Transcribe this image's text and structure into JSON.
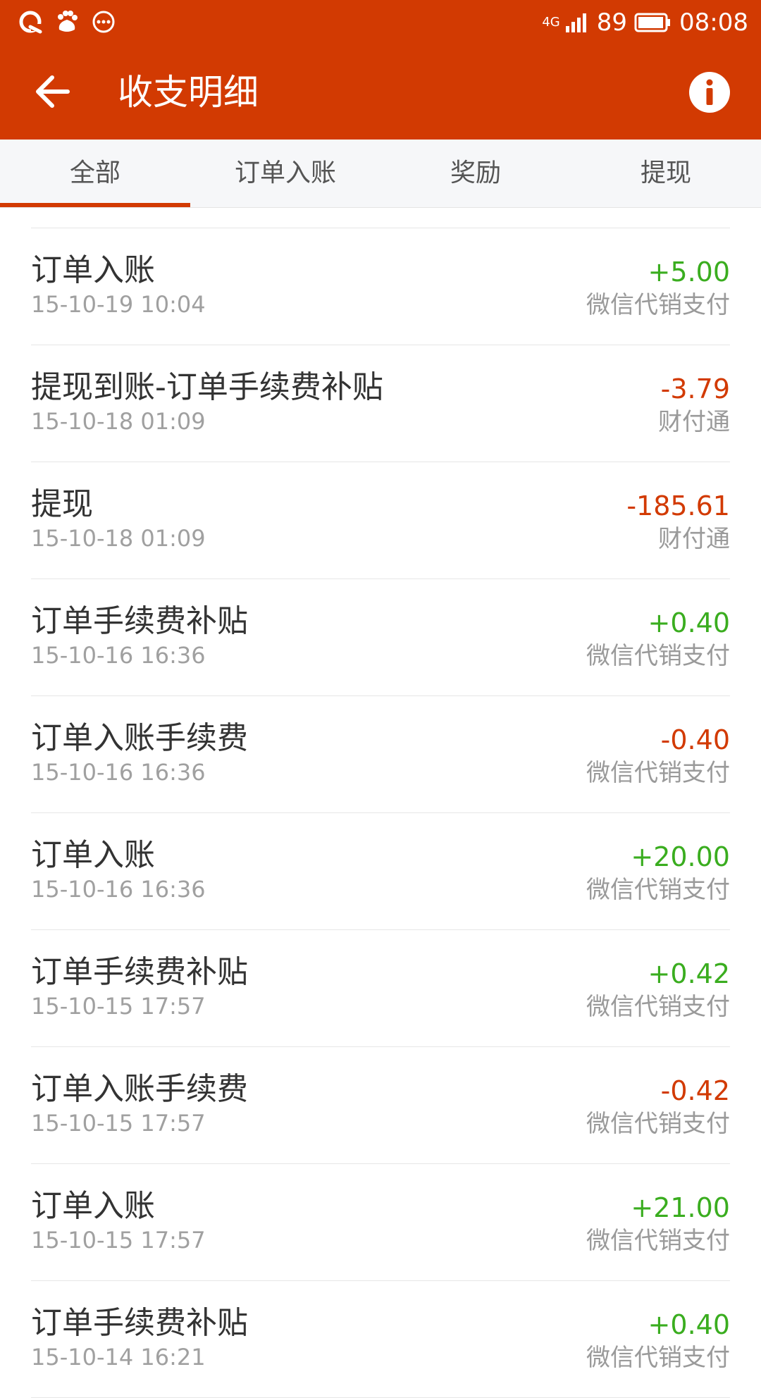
{
  "status_bar": {
    "network": "4G",
    "battery": "89",
    "time": "08:08",
    "left_icons": [
      "qq-icon",
      "baidu-icon",
      "more-dots-icon"
    ]
  },
  "header": {
    "title": "收支明细"
  },
  "tabs": [
    {
      "label": "全部",
      "active": true
    },
    {
      "label": "订单入账",
      "active": false
    },
    {
      "label": "奖励",
      "active": false
    },
    {
      "label": "提现",
      "active": false
    }
  ],
  "colors": {
    "brand": "#d23a02",
    "positive": "#3aad1f",
    "negative": "#d23a02"
  },
  "transactions": [
    {
      "title": "订单入账",
      "time": "15-10-19 10:04",
      "amount": "+5.00",
      "sign": "pos",
      "channel": "微信代销支付"
    },
    {
      "title": "提现到账-订单手续费补贴",
      "time": "15-10-18 01:09",
      "amount": "-3.79",
      "sign": "neg",
      "channel": "财付通"
    },
    {
      "title": "提现",
      "time": "15-10-18 01:09",
      "amount": "-185.61",
      "sign": "neg",
      "channel": "财付通"
    },
    {
      "title": "订单手续费补贴",
      "time": "15-10-16 16:36",
      "amount": "+0.40",
      "sign": "pos",
      "channel": "微信代销支付"
    },
    {
      "title": "订单入账手续费",
      "time": "15-10-16 16:36",
      "amount": "-0.40",
      "sign": "neg",
      "channel": "微信代销支付"
    },
    {
      "title": "订单入账",
      "time": "15-10-16 16:36",
      "amount": "+20.00",
      "sign": "pos",
      "channel": "微信代销支付"
    },
    {
      "title": "订单手续费补贴",
      "time": "15-10-15 17:57",
      "amount": "+0.42",
      "sign": "pos",
      "channel": "微信代销支付"
    },
    {
      "title": "订单入账手续费",
      "time": "15-10-15 17:57",
      "amount": "-0.42",
      "sign": "neg",
      "channel": "微信代销支付"
    },
    {
      "title": "订单入账",
      "time": "15-10-15 17:57",
      "amount": "+21.00",
      "sign": "pos",
      "channel": "微信代销支付"
    },
    {
      "title": "订单手续费补贴",
      "time": "15-10-14 16:21",
      "amount": "+0.40",
      "sign": "pos",
      "channel": "微信代销支付"
    }
  ]
}
